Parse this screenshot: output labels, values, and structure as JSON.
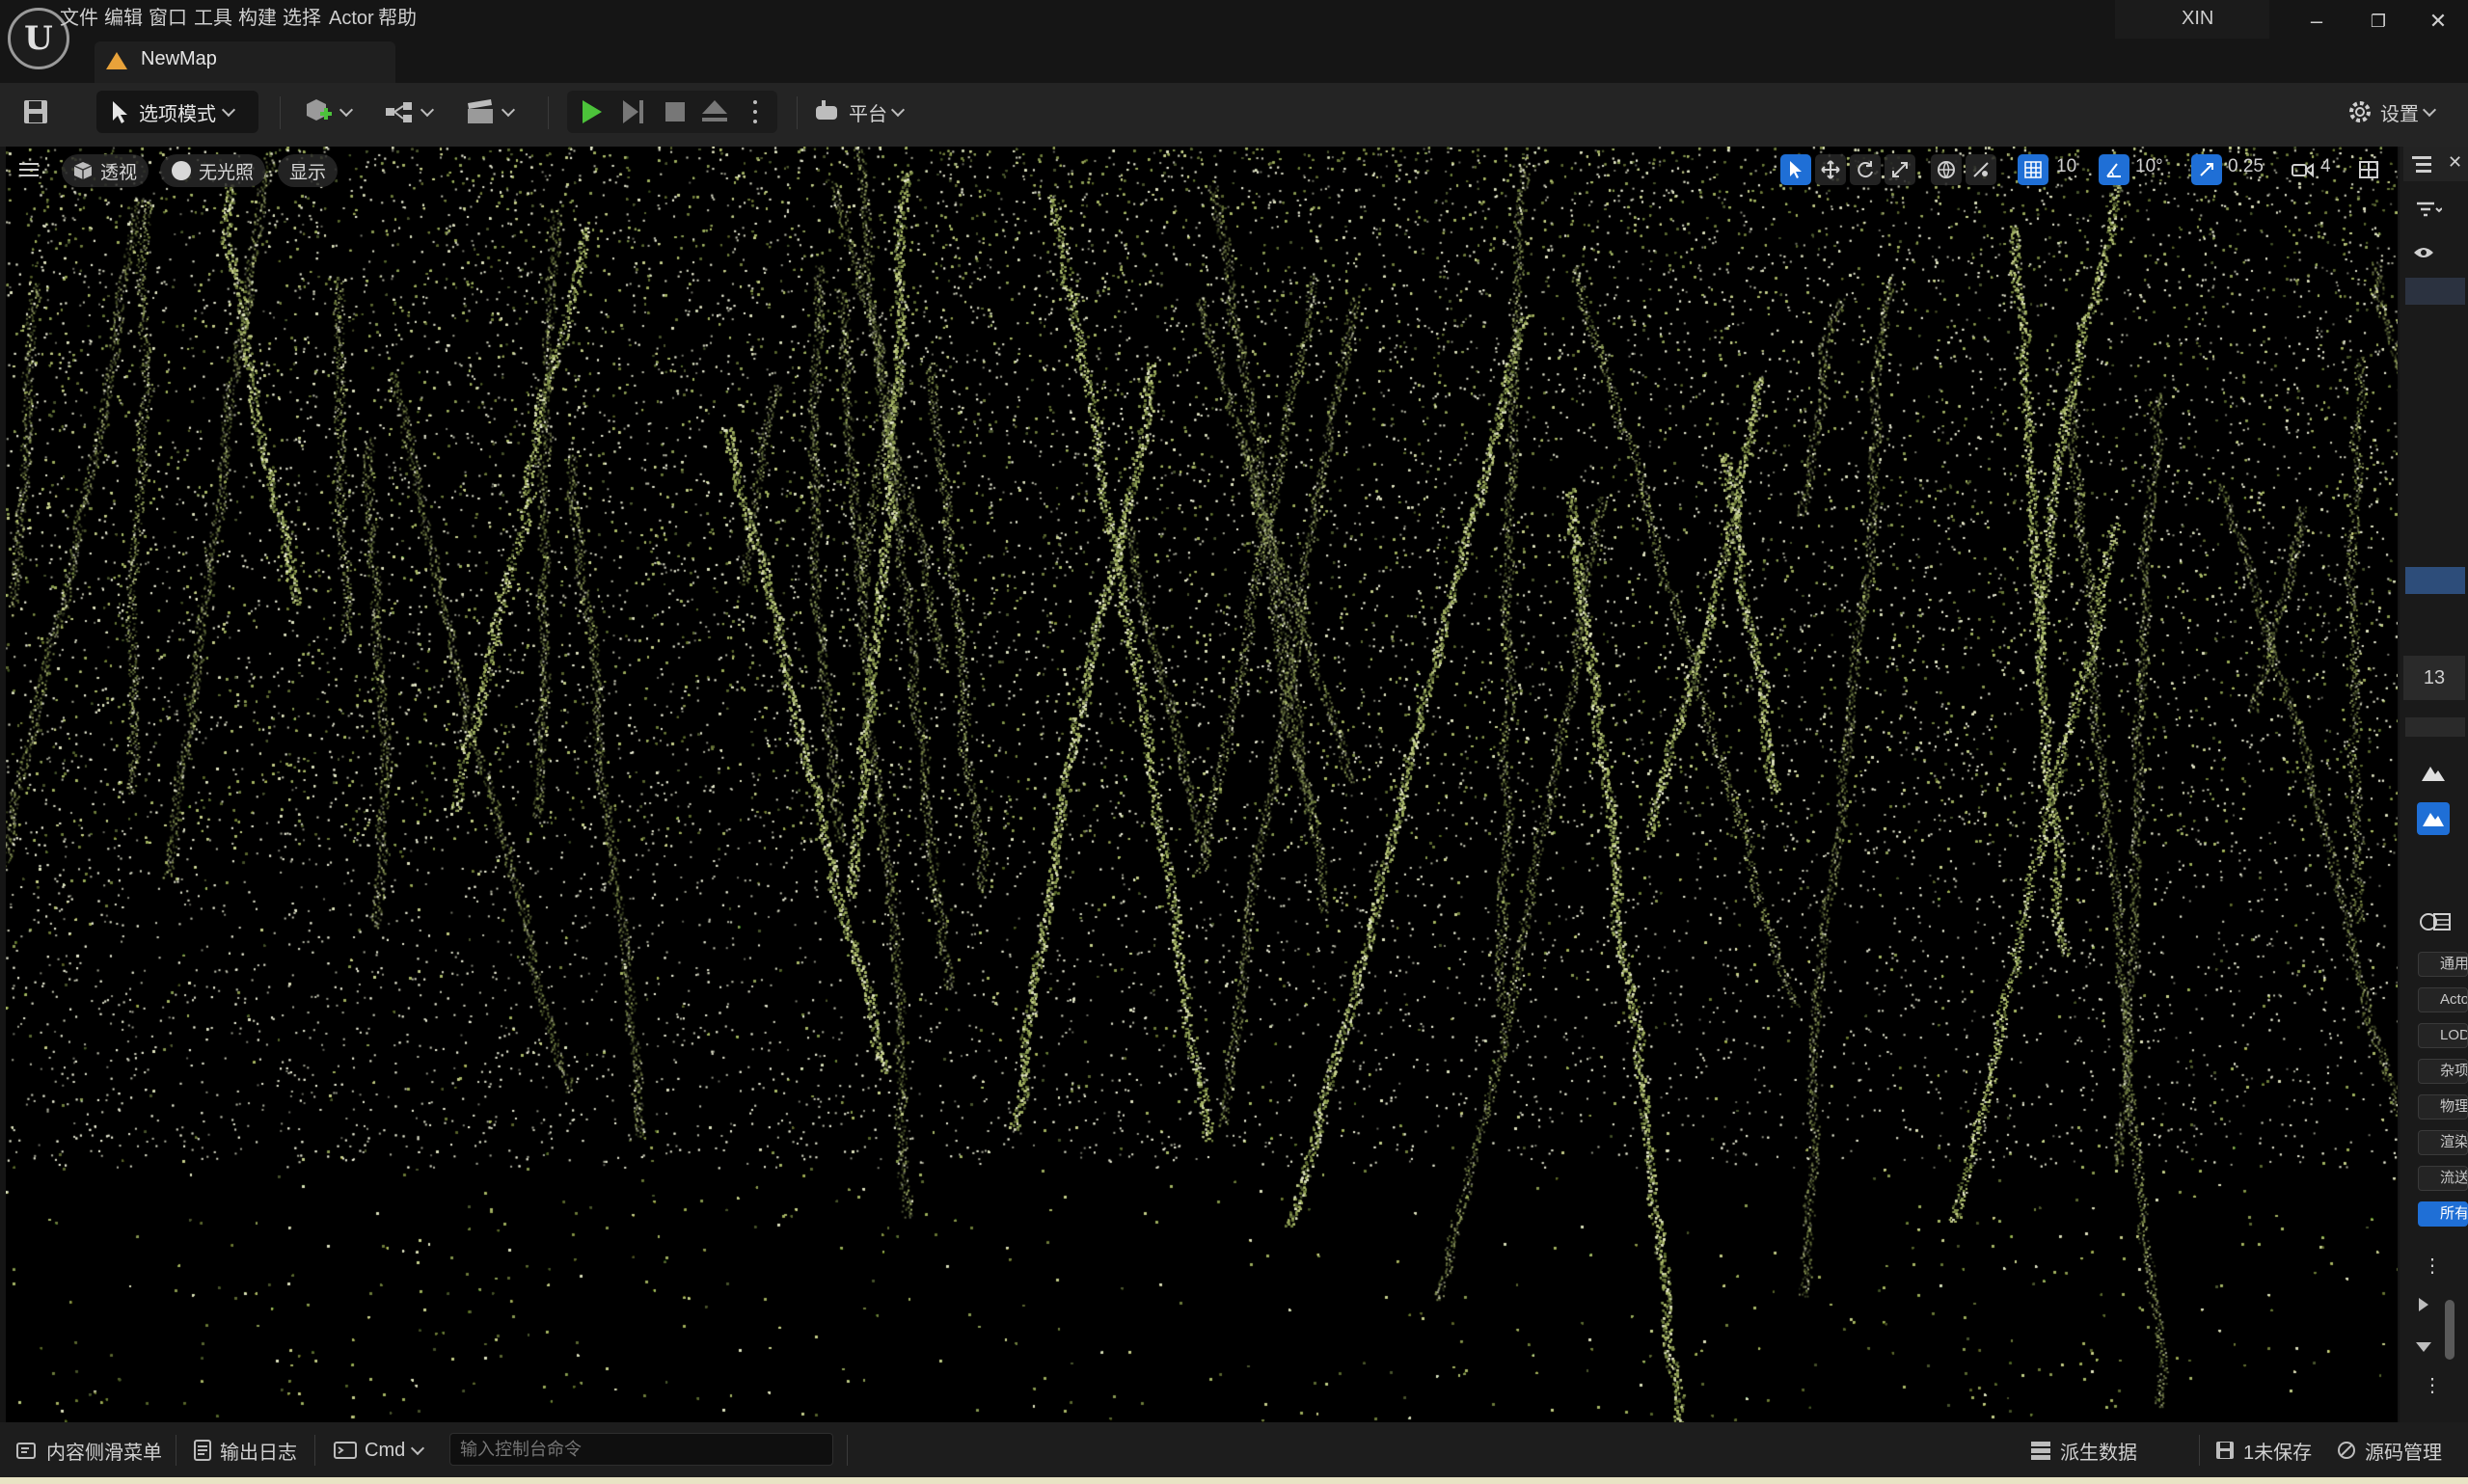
{
  "menu": {
    "items": [
      "文件",
      "编辑",
      "窗口",
      "工具",
      "构建",
      "选择",
      "Actor",
      "帮助"
    ]
  },
  "tab": {
    "label": "NewMap"
  },
  "user": {
    "name": "XIN"
  },
  "logo": {
    "glyph": "U"
  },
  "window_controls": {
    "minimize": "–",
    "restore": "❐",
    "close": "✕"
  },
  "toolbar": {
    "mode_label": "选项模式",
    "platform_label": "平台",
    "settings_label": "设置"
  },
  "viewport": {
    "perspective_label": "透视",
    "lighting_label": "无光照",
    "show_label": "显示",
    "grid_snap_value": "10",
    "rotation_snap_value": "10°",
    "scale_snap_value": "0.25",
    "camera_speed_value": "4"
  },
  "right_panel": {
    "number_value": "13",
    "categories": [
      "通用",
      "Actor",
      "LOD",
      "杂项",
      "物理",
      "渲染",
      "流送",
      "所有"
    ]
  },
  "statusbar": {
    "content_drawer_label": "内容侧滑菜单",
    "output_log_label": "输出日志",
    "cmd_label": "Cmd",
    "console_placeholder": "输入控制台命令",
    "derived_data_label": "派生数据",
    "unsaved_label": "1未保存",
    "source_control_label": "源码管理"
  },
  "colors": {
    "play_green": "#4cc23a",
    "accent_blue": "#1f6fd6",
    "tab_icon_orange": "#e8a23a"
  },
  "icons": [
    "save-icon",
    "mode-icon",
    "add-actor-icon",
    "blueprint-icon",
    "cinematics-icon",
    "play-icon",
    "step-icon",
    "stop-icon",
    "eject-icon",
    "platform-icon",
    "settings-gear-icon",
    "hamburger-icon",
    "perspective-cube-icon",
    "lighting-sphere-icon",
    "select-arrow-icon",
    "translate-icon",
    "rotate-icon",
    "scale-icon",
    "world-icon",
    "surface-snap-icon",
    "grid-icon",
    "angle-icon",
    "scale-snap-icon",
    "camera-icon",
    "layout-icon"
  ]
}
